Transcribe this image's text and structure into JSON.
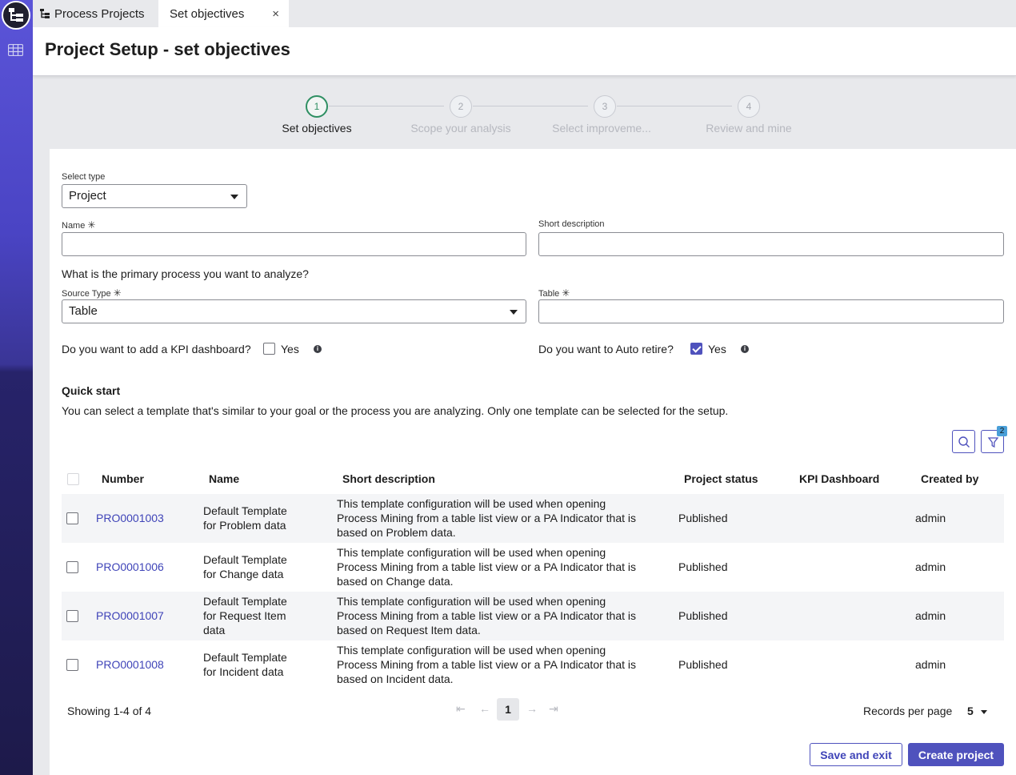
{
  "tabs": [
    {
      "label": "Process Projects"
    },
    {
      "label": "Set objectives",
      "close": "×"
    }
  ],
  "page": {
    "title": "Project Setup - set objectives"
  },
  "stepper": {
    "steps": [
      {
        "number": "1",
        "label": "Set objectives"
      },
      {
        "number": "2",
        "label": "Scope your analysis"
      },
      {
        "number": "3",
        "label": "Select improveme..."
      },
      {
        "number": "4",
        "label": "Review and mine"
      }
    ]
  },
  "form": {
    "select_type": {
      "label": "Select type",
      "value": "Project"
    },
    "name": {
      "label": "Name",
      "required_mark": "✳",
      "value": ""
    },
    "short_description": {
      "label": "Short description",
      "value": ""
    },
    "primary_process_question": "What is the primary process you want to analyze?",
    "source_type": {
      "label": "Source Type",
      "required_mark": "✳",
      "value": "Table"
    },
    "table": {
      "label": "Table",
      "required_mark": "✳",
      "value": ""
    },
    "kpi_dashboard": {
      "question": "Do you want to add a KPI dashboard?",
      "option": "Yes",
      "checked": false
    },
    "auto_retire": {
      "question": "Do you want to Auto retire?",
      "option": "Yes",
      "checked": true
    }
  },
  "quick_start": {
    "title": "Quick start",
    "description": "You can select a template that's similar to your goal or the process you are analyzing. Only one template can be selected for the setup.",
    "filter_badge": "2",
    "columns": [
      "Number",
      "Name",
      "Short description",
      "Project status",
      "KPI Dashboard",
      "Created by"
    ],
    "rows": [
      {
        "number": "PRO0001003",
        "name_lines": [
          "Default Template",
          "for Problem data"
        ],
        "desc_lines": [
          "This template configuration will be used when opening",
          "Process Mining from a table list view or a PA Indicator that is",
          "based on Problem data."
        ],
        "status": "Published",
        "kpi": "",
        "created_by": "admin"
      },
      {
        "number": "PRO0001006",
        "name_lines": [
          "Default Template",
          "for Change data"
        ],
        "desc_lines": [
          "This template configuration will be used when opening",
          "Process Mining from a table list view or a PA Indicator that is",
          "based on Change data."
        ],
        "status": "Published",
        "kpi": "",
        "created_by": "admin"
      },
      {
        "number": "PRO0001007",
        "name_lines": [
          "Default Template",
          "for Request Item",
          "data"
        ],
        "desc_lines": [
          "This template configuration will be used when opening",
          "Process Mining from a table list view or a PA Indicator that is",
          "based on Request Item data."
        ],
        "status": "Published",
        "kpi": "",
        "created_by": "admin"
      },
      {
        "number": "PRO0001008",
        "name_lines": [
          "Default Template",
          "for Incident data"
        ],
        "desc_lines": [
          "This template configuration will be used when opening",
          "Process Mining from a table list view or a PA Indicator that is",
          "based on Incident data."
        ],
        "status": "Published",
        "kpi": "",
        "created_by": "admin"
      }
    ],
    "showing": "Showing 1-4 of 4",
    "current_page": "1",
    "records_per_page_label": "Records per page",
    "records_per_page": "5"
  },
  "actions": {
    "save_exit": "Save and exit",
    "create": "Create project"
  },
  "colors": {
    "accent": "#4f52bd",
    "link": "#3f44b8",
    "active_step": "#2e8f62"
  }
}
